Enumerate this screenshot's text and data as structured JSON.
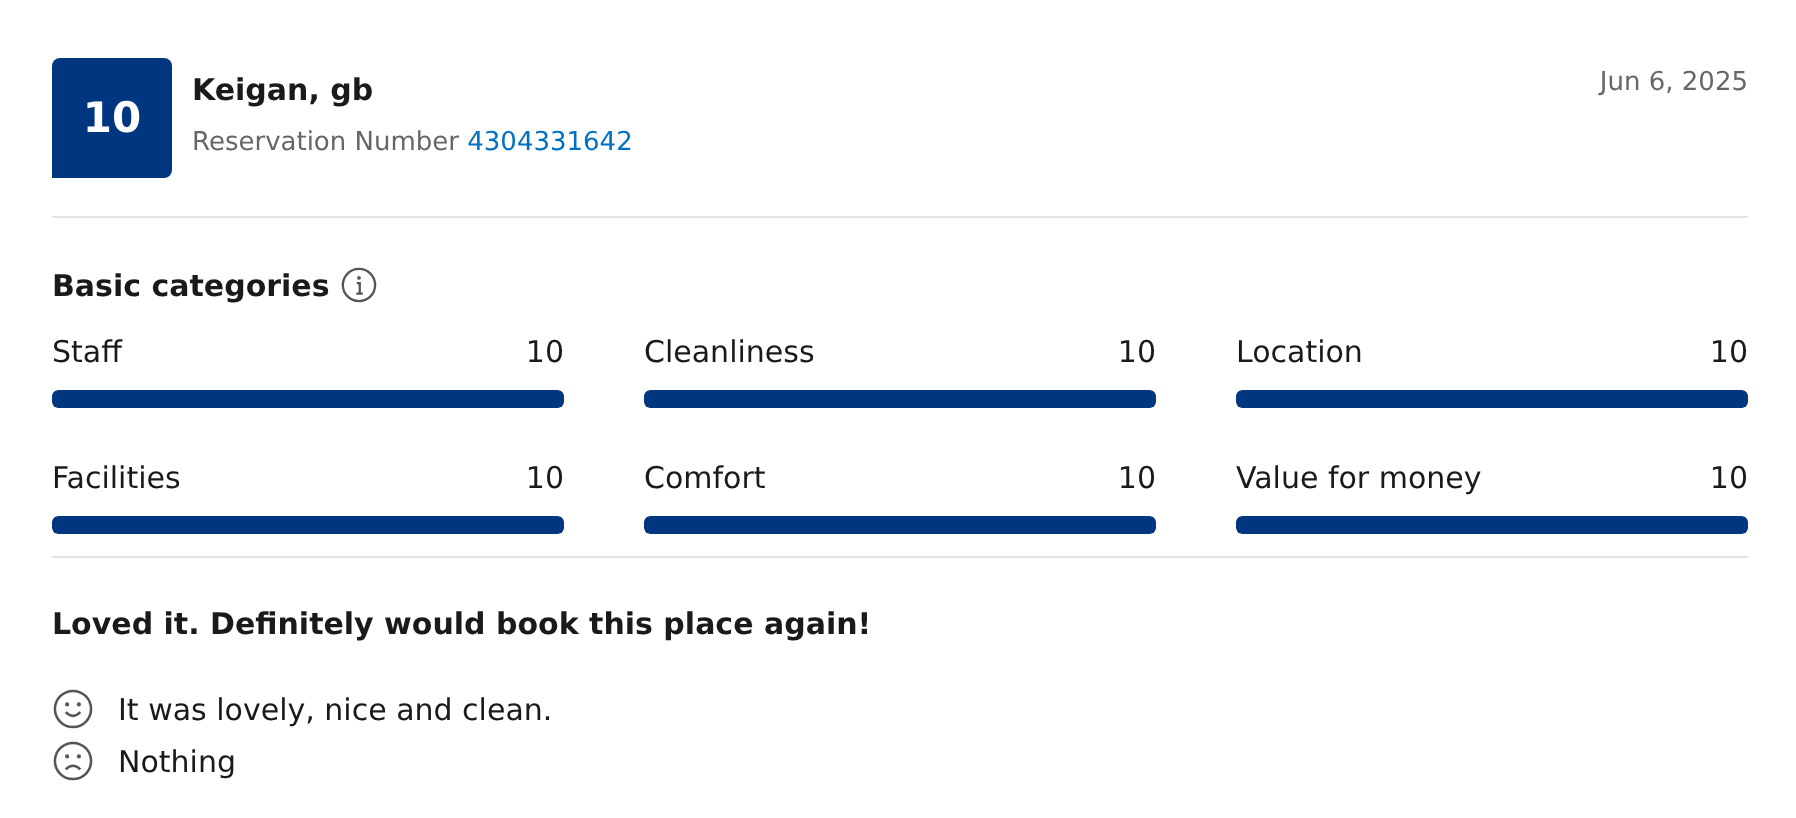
{
  "review": {
    "score": "10",
    "reviewer": "Keigan, gb",
    "reservation_label": "Reservation Number",
    "reservation_number": "4304331642",
    "date": "Jun 6, 2025"
  },
  "categories_title": "Basic categories",
  "categories": [
    {
      "name": "Staff",
      "score": "10",
      "level": 1
    },
    {
      "name": "Cleanliness",
      "score": "10",
      "level": 1
    },
    {
      "name": "Location",
      "score": "10",
      "level": 1
    },
    {
      "name": "Facilities",
      "score": "10",
      "level": 1
    },
    {
      "name": "Comfort",
      "score": "10",
      "level": 1
    },
    {
      "name": "Value for money",
      "score": "10",
      "level": 1
    }
  ],
  "headline": "Loved it. Definitely would book this place again!",
  "comments": [
    {
      "kind": "positive",
      "text": "It was lovely, nice and clean."
    },
    {
      "kind": "negative",
      "text": "Nothing"
    }
  ]
}
